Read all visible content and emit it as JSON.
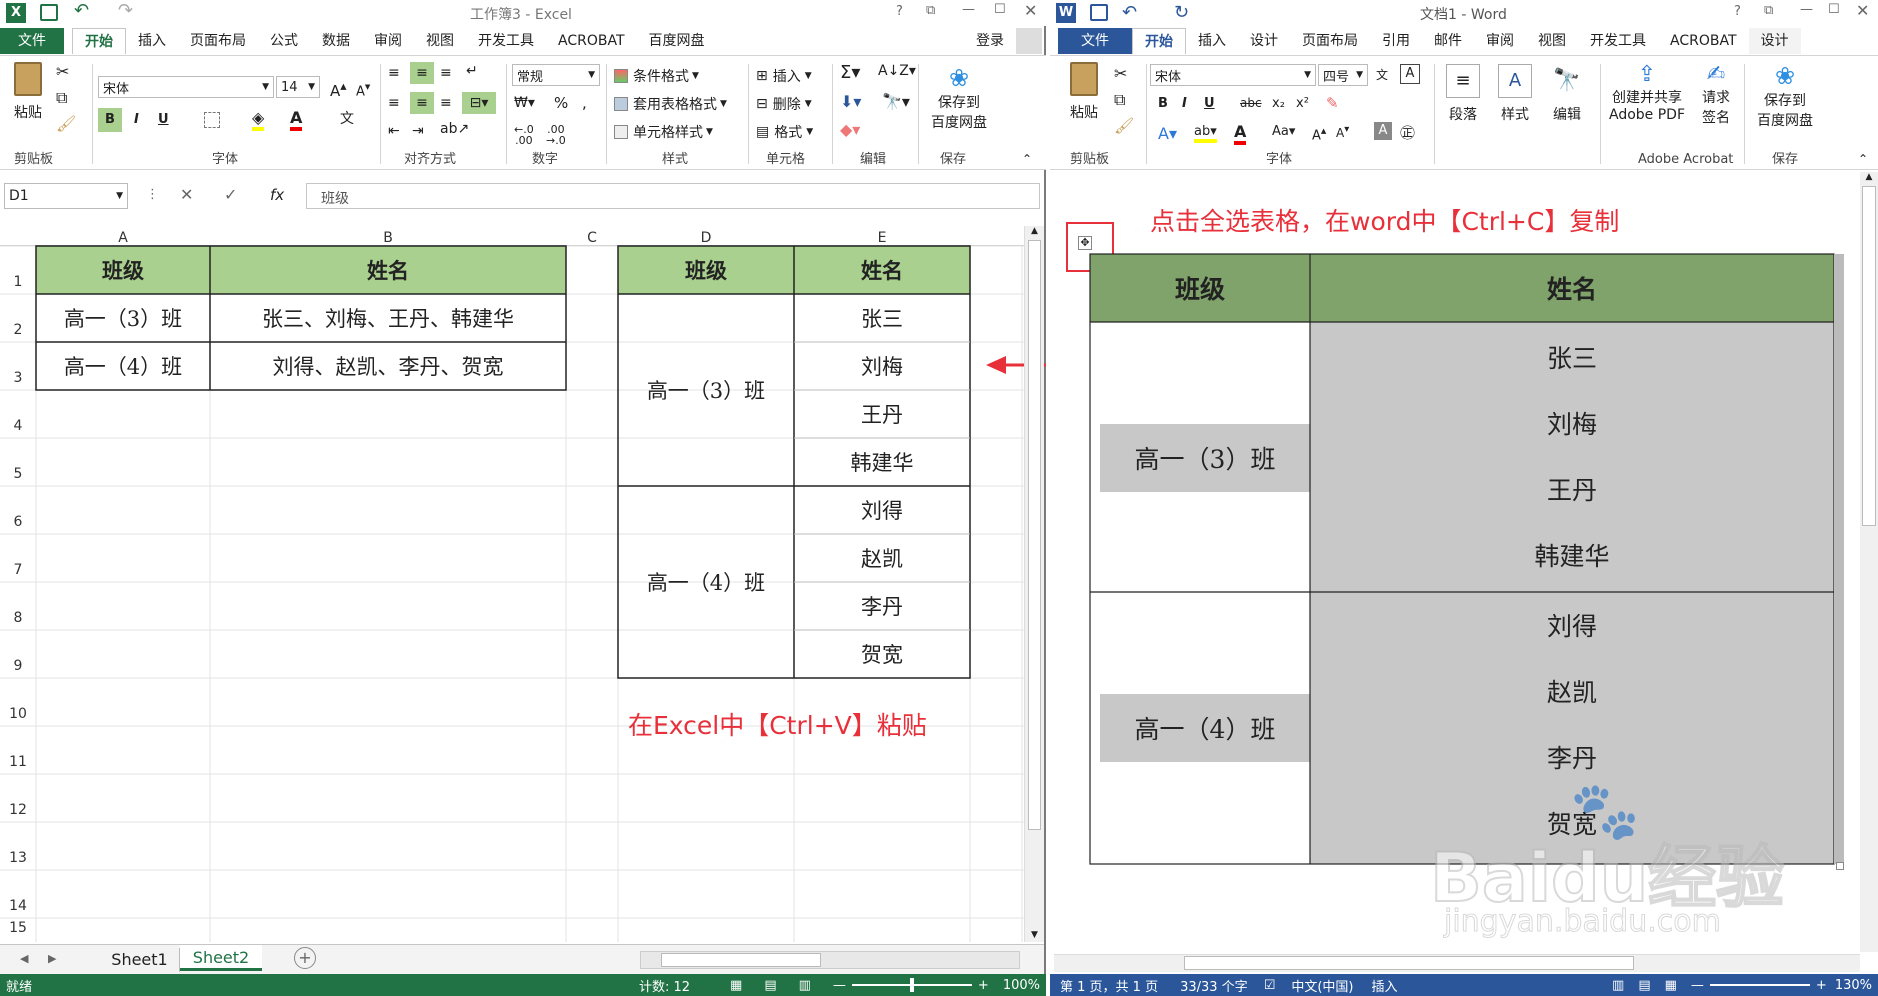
{
  "excel": {
    "title": "工作簿3 - Excel",
    "app_icon": "X",
    "file_tab": "文件",
    "tabs": [
      "开始",
      "插入",
      "页面布局",
      "公式",
      "数据",
      "审阅",
      "视图",
      "开发工具",
      "ACROBAT",
      "百度网盘"
    ],
    "login": "登录",
    "ribbon": {
      "font_name": "宋体",
      "font_size": "14",
      "paste_label": "粘贴",
      "number_format": "常规",
      "cond_format": "条件格式",
      "table_format": "套用表格格式",
      "cell_style": "单元格样式",
      "insert": "插入",
      "delete": "删除",
      "format": "格式",
      "save_baidu_1": "保存到",
      "save_baidu_2": "百度网盘",
      "bold": "B",
      "italic": "I",
      "underline": "U",
      "groups": [
        "剪贴板",
        "字体",
        "对齐方式",
        "数字",
        "样式",
        "单元格",
        "编辑",
        "保存"
      ]
    },
    "name_box": "D1",
    "formula_value": "班级",
    "fx": "fx",
    "columns": [
      "A",
      "B",
      "C",
      "D",
      "E"
    ],
    "rows": [
      "1",
      "2",
      "3",
      "4",
      "5",
      "6",
      "7",
      "8",
      "9",
      "10",
      "11",
      "12",
      "13",
      "14",
      "15"
    ],
    "table1": {
      "headers": [
        "班级",
        "姓名"
      ],
      "rows": [
        [
          "高一（3）班",
          "张三、刘梅、王丹、韩建华"
        ],
        [
          "高一（4）班",
          "刘得、赵凯、李丹、贺宽"
        ]
      ]
    },
    "table2": {
      "headers": [
        "班级",
        "姓名"
      ],
      "groups": [
        {
          "class": "高一（3）班",
          "names": [
            "张三",
            "刘梅",
            "王丹",
            "韩建华"
          ]
        },
        {
          "class": "高一（4）班",
          "names": [
            "刘得",
            "赵凯",
            "李丹",
            "贺宽"
          ]
        }
      ]
    },
    "paste_annotation": "在Excel中【Ctrl+V】粘贴",
    "sheets": [
      "Sheet1",
      "Sheet2"
    ],
    "active_sheet": "Sheet2",
    "status_left": "就绪",
    "status_count": "计数: 12",
    "zoom": "100%"
  },
  "word": {
    "title": "文档1 - Word",
    "app_icon": "W",
    "file_tab": "文件",
    "tabs": [
      "开始",
      "插入",
      "设计",
      "页面布局",
      "引用",
      "邮件",
      "审阅",
      "视图",
      "开发工具",
      "ACROBAT",
      "设计"
    ],
    "ribbon": {
      "font_name": "宋体",
      "font_size": "四号",
      "paste_label": "粘贴",
      "paragraph": "段落",
      "styles": "样式",
      "editing": "编辑",
      "create_pdf_1": "创建并共享",
      "create_pdf_2": "Adobe PDF",
      "sign_1": "请求",
      "sign_2": "签名",
      "save_baidu_1": "保存到",
      "save_baidu_2": "百度网盘",
      "bold": "B",
      "italic": "I",
      "underline": "U",
      "groups": [
        "剪贴板",
        "字体",
        "Adobe Acrobat",
        "保存"
      ]
    },
    "copy_annotation": "点击全选表格，在word中【Ctrl+C】复制",
    "table": {
      "headers": [
        "班级",
        "姓名"
      ],
      "groups": [
        {
          "class": "高一（3）班",
          "names": [
            "张三",
            "刘梅",
            "王丹",
            "韩建华"
          ]
        },
        {
          "class": "高一（4）班",
          "names": [
            "刘得",
            "赵凯",
            "李丹",
            "贺宽"
          ]
        }
      ]
    },
    "status_page": "第 1 页，共 1 页",
    "status_words": "33/33 个字",
    "status_lang": "中文(中国)",
    "status_mode": "插入",
    "zoom": "130%"
  },
  "watermark": {
    "brand": "Baidu经验",
    "url": "jingyan.baidu.com"
  },
  "colors": {
    "excel_green": "#217346",
    "word_blue": "#2b579a",
    "header_fill": "#a9d08e",
    "word_header_fill": "#7fa36a",
    "selection_gray": "#c8c8c8",
    "annotation_red": "#e8303a"
  }
}
